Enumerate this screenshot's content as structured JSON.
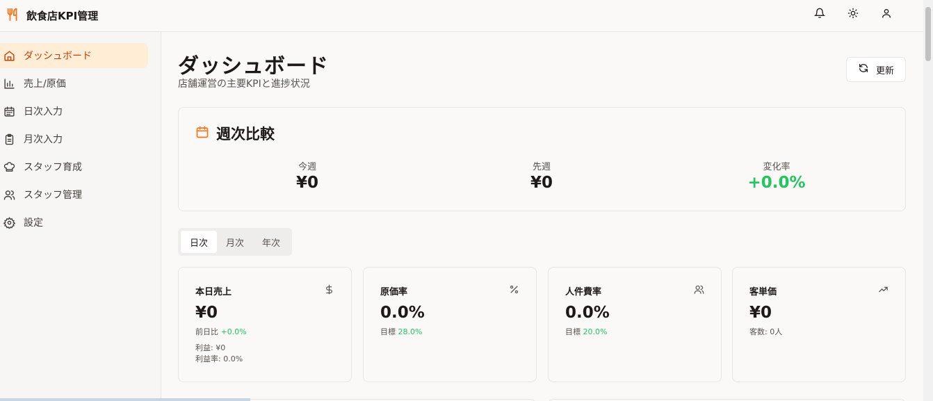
{
  "app": {
    "title": "飲食店KPI管理"
  },
  "colors": {
    "accent": "#f97316",
    "positive": "#22c55e",
    "active_bg": "#ffedd5"
  },
  "header": {
    "icons": [
      "bell-icon",
      "sun-icon",
      "user-icon"
    ]
  },
  "sidebar": {
    "items": [
      {
        "label": "ダッシュボード",
        "icon": "home-icon",
        "active": true
      },
      {
        "label": "売上/原価",
        "icon": "bar-chart-icon",
        "active": false
      },
      {
        "label": "日次入力",
        "icon": "calendar-icon",
        "active": false
      },
      {
        "label": "月次入力",
        "icon": "clipboard-icon",
        "active": false
      },
      {
        "label": "スタッフ育成",
        "icon": "chef-hat-icon",
        "active": false
      },
      {
        "label": "スタッフ管理",
        "icon": "users-icon",
        "active": false
      },
      {
        "label": "設定",
        "icon": "gear-icon",
        "active": false
      }
    ]
  },
  "page": {
    "title": "ダッシュボード",
    "subtitle": "店舗運営の主要KPIと進捗状況",
    "refresh_label": "更新"
  },
  "weekly": {
    "title": "週次比較",
    "this_week": {
      "label": "今週",
      "value": "¥0"
    },
    "last_week": {
      "label": "先週",
      "value": "¥0"
    },
    "change": {
      "label": "変化率",
      "value": "+0.0%"
    }
  },
  "tabs": [
    {
      "label": "日次",
      "active": true
    },
    {
      "label": "月次",
      "active": false
    },
    {
      "label": "年次",
      "active": false
    }
  ],
  "kpis": [
    {
      "label": "本日売上",
      "icon": "dollar-icon",
      "value": "¥0",
      "sub_prefix": "前日比",
      "sub_value": "+0.0%",
      "extra1": "利益: ¥0",
      "extra2": "利益率: 0.0%"
    },
    {
      "label": "原価率",
      "icon": "percent-icon",
      "value": "0.0%",
      "sub_prefix": "目標",
      "sub_value": "28.0%"
    },
    {
      "label": "人件費率",
      "icon": "users-icon",
      "value": "0.0%",
      "sub_prefix": "目標",
      "sub_value": "20.0%"
    },
    {
      "label": "客単価",
      "icon": "trending-up-icon",
      "value": "¥0",
      "sub_prefix": "客数: 0人"
    }
  ]
}
